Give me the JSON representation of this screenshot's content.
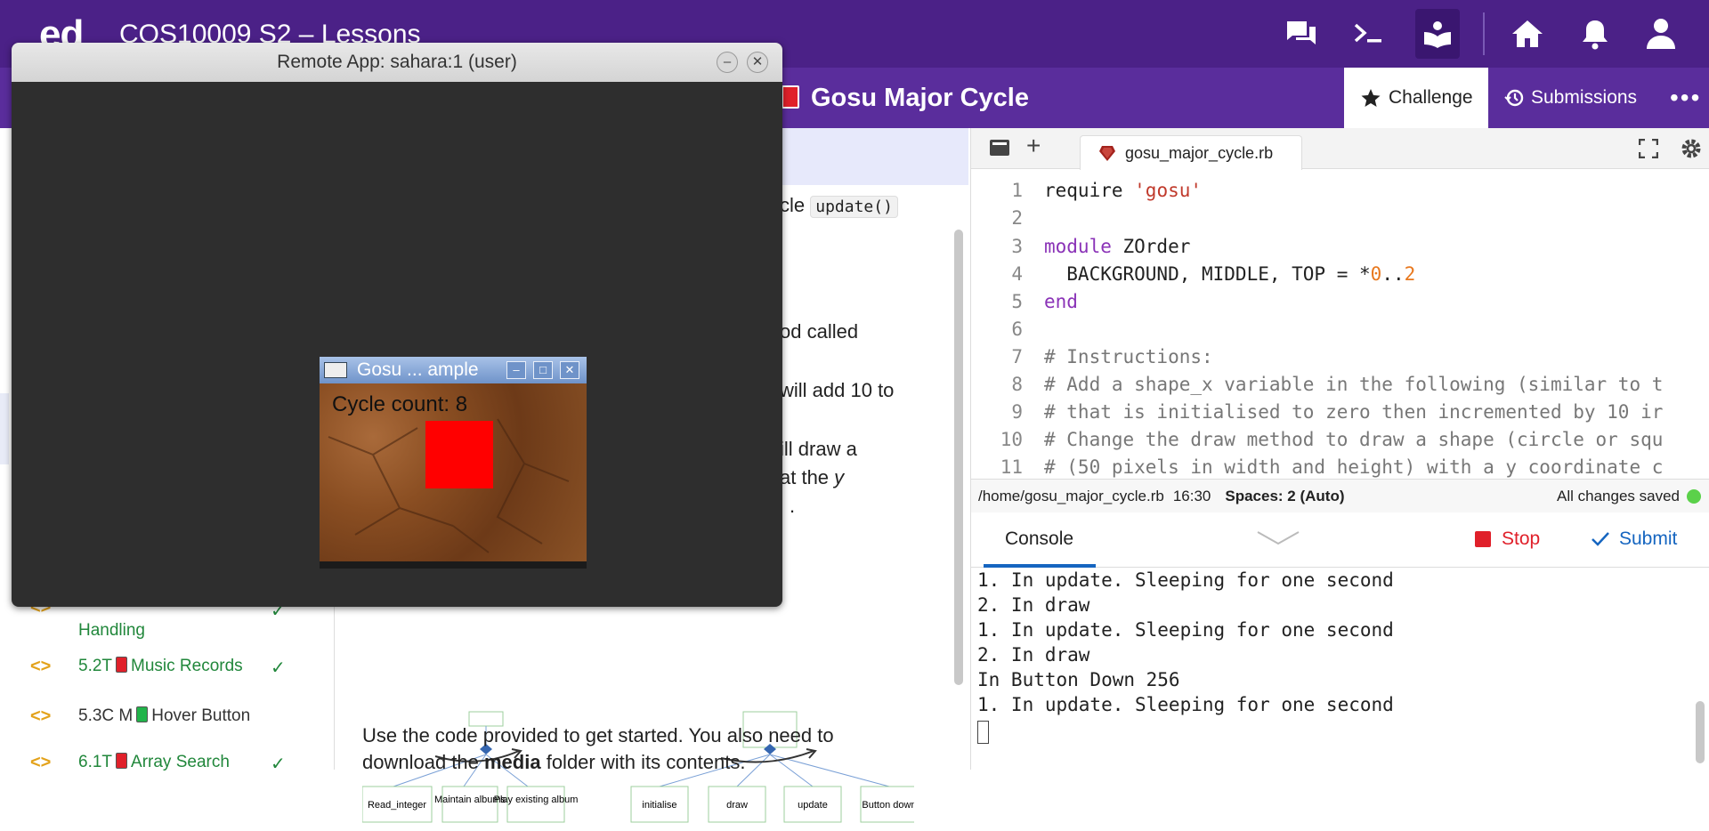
{
  "topbar": {
    "logo": "ed",
    "course": "COS10009 S2 – Lessons",
    "icons": [
      "discussion-icon",
      "terminal-icon",
      "lessons-icon",
      "home-icon",
      "bell-icon",
      "user-icon"
    ]
  },
  "lesson": {
    "title": "Gosu Major Cycle",
    "challenge_tab": "Challenge",
    "submissions_tab": "Submissions",
    "more": "•••"
  },
  "sidebar": {
    "items": [
      {
        "label": "Handling",
        "code": "",
        "check": "✓",
        "book_color": ""
      },
      {
        "label": "Music Records",
        "code": "5.2T",
        "check": "✓",
        "book_color": "#e0202a"
      },
      {
        "label": "Hover Button",
        "code": "5.3C M",
        "check": "",
        "book_color": "#21b34a"
      },
      {
        "label": "Array Search",
        "code": "6.1T",
        "check": "✓",
        "book_color": "#e0202a"
      }
    ]
  },
  "content": {
    "cycle_text": "cle",
    "update_code": "update()",
    "line1": "od called",
    "line2": "will add 10 to",
    "line3": "ill draw a",
    "line4a": "at the ",
    "line4b": "y",
    "line5": ".",
    "diagram_left": [
      "Read_integer",
      "Maintain albums",
      "Play existing album"
    ],
    "diagram_right": [
      "initialise",
      "draw",
      "update",
      "Button down"
    ],
    "para1": "Use the code provided to get started. You also need to",
    "para2a": "download the ",
    "para2b": "media",
    "para2c": " folder with its contents."
  },
  "editor": {
    "filename": "gosu_major_cycle.rb",
    "lines": [
      {
        "n": "1",
        "t": "require 'gosu'"
      },
      {
        "n": "2",
        "t": ""
      },
      {
        "n": "3",
        "t": "module ZOrder"
      },
      {
        "n": "4",
        "t": "  BACKGROUND, MIDDLE, TOP = *0..2"
      },
      {
        "n": "5",
        "t": "end"
      },
      {
        "n": "6",
        "t": ""
      },
      {
        "n": "7",
        "t": "# Instructions:"
      },
      {
        "n": "8",
        "t": "# Add a shape_x variable in the following (similar to t"
      },
      {
        "n": "9",
        "t": "# that is initialised to zero then incremented by 10 ir"
      },
      {
        "n": "10",
        "t": "# Change the draw method to draw a shape (circle or squ"
      },
      {
        "n": "11",
        "t": "# (50 pixels in width and height) with a y coordinate c"
      }
    ],
    "path": "/home/gosu_major_cycle.rb",
    "cursor": "16:30",
    "spaces": "Spaces: 2 (Auto)",
    "saved": "All changes saved"
  },
  "console": {
    "tab": "Console",
    "stop": "Stop",
    "submit": "Submit",
    "lines": [
      "1. In update. Sleeping for one second",
      "2. In draw",
      "1. In update. Sleeping for one second",
      "2. In draw",
      "In Button Down 256",
      "1. In update. Sleeping for one second"
    ]
  },
  "remote": {
    "title": "Remote App: sahara:1 (user)",
    "gosu_title": "Gosu ... ample",
    "cycle_label": "Cycle count: 8"
  },
  "colors": {
    "brand": "#4b2187",
    "accent": "#1565c0",
    "stop": "#e0202a",
    "ok": "#21873b"
  }
}
